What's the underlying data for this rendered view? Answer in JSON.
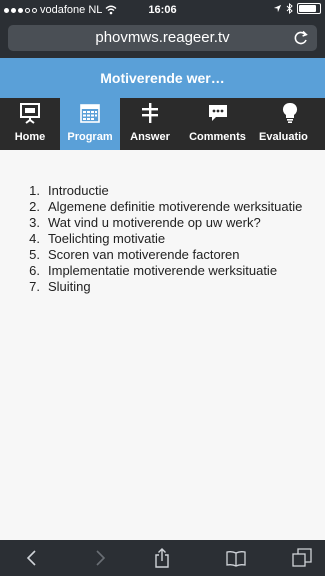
{
  "status_bar": {
    "carrier": "vodafone NL",
    "time": "16:06",
    "battery_level": 0.92
  },
  "browser": {
    "url": "phovmws.reageer.tv"
  },
  "page": {
    "title": "Motiverende wer…"
  },
  "nav": {
    "items": [
      {
        "label": "Home",
        "icon": "presentation-icon",
        "active": false
      },
      {
        "label": "Program",
        "icon": "calendar-icon",
        "active": true
      },
      {
        "label": "Answer",
        "icon": "signpost-icon",
        "active": false
      },
      {
        "label": "Comments",
        "icon": "speech-bubble-icon",
        "active": false
      },
      {
        "label": "Evaluatio",
        "icon": "lightbulb-icon",
        "active": false
      }
    ]
  },
  "agenda": {
    "items": [
      {
        "number": "1.",
        "text": "Introductie"
      },
      {
        "number": "2.",
        "text": "Algemene definitie motiverende werksituatie"
      },
      {
        "number": "3.",
        "text": "Wat vind u motiverende op uw werk?"
      },
      {
        "number": "4.",
        "text": "Toelichting motivatie"
      },
      {
        "number": "5.",
        "text": "Scoren van motiverende factoren"
      },
      {
        "number": "6.",
        "text": "Implementatie motiverende werksituatie"
      },
      {
        "number": "7.",
        "text": "Sluiting"
      }
    ]
  },
  "colors": {
    "accent": "#5aa0d8",
    "chrome": "#2b2f34",
    "nav_bg": "#2b2b2b"
  }
}
